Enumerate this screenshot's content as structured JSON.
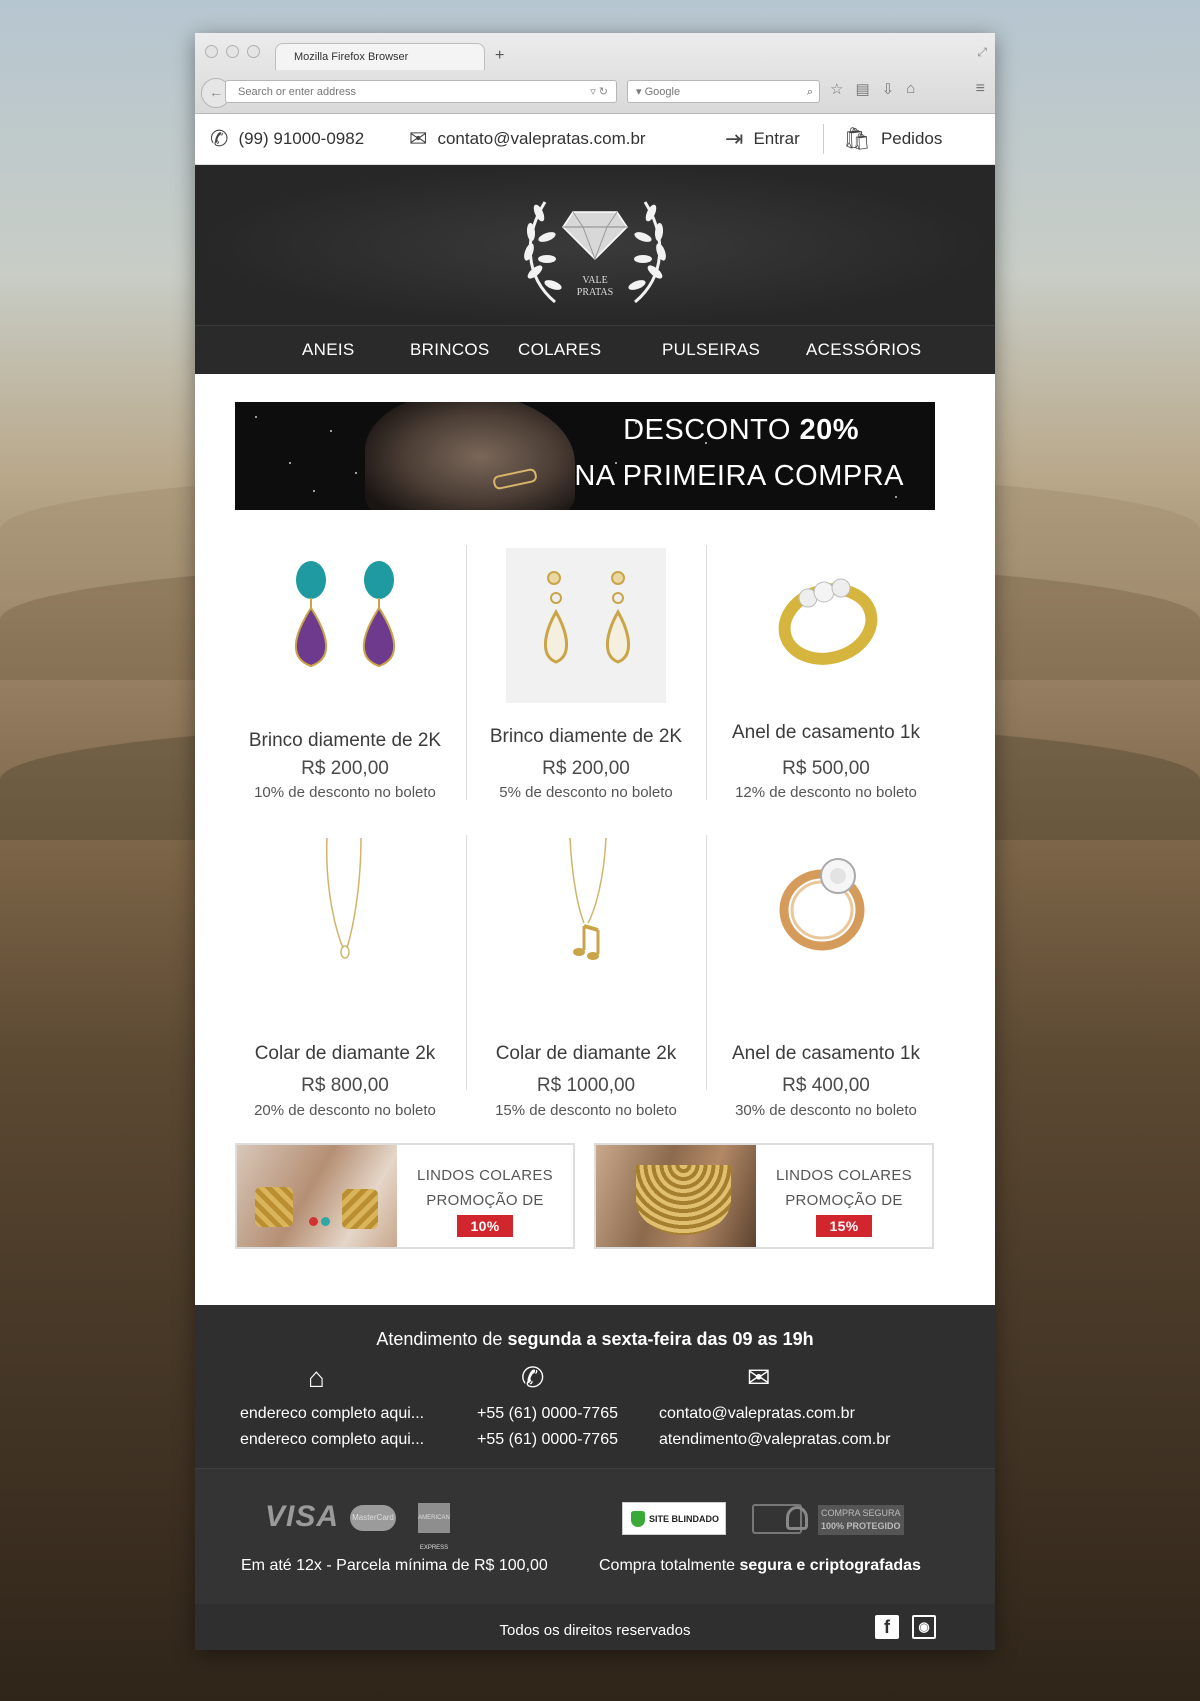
{
  "browser": {
    "tab_title": "Mozilla Firefox Browser",
    "url_placeholder": "Search or enter address",
    "search_placeholder": "Google"
  },
  "topbar": {
    "phone": "(99) 91000-0982",
    "email": "contato@valepratas.com.br",
    "login": "Entrar",
    "orders": "Pedidos"
  },
  "logo": {
    "line1": "VALE",
    "line2": "PRATAS"
  },
  "nav": [
    "ANEIS",
    "BRINCOS",
    "COLARES",
    "PULSEIRAS",
    "ACESSÓRIOS"
  ],
  "banner": {
    "line1_prefix": "DESCONTO ",
    "line1_bold": "20%",
    "line2": "NA PRIMEIRA COMPRA"
  },
  "products": [
    {
      "name": "Brinco diamente de 2K",
      "price": "R$ 200,00",
      "discount": "10% de desconto no boleto",
      "icon": "amethyst-earrings-icon"
    },
    {
      "name": "Brinco diamente de 2K",
      "price": "R$ 200,00",
      "discount": "5% de desconto no boleto",
      "icon": "gold-earrings-icon"
    },
    {
      "name": "Anel de casamento 1k",
      "price": "R$ 500,00",
      "discount": "12% de desconto no boleto",
      "icon": "gold-ring-icon"
    },
    {
      "name": "Colar de diamante 2k",
      "price": "R$ 800,00",
      "discount": "20% de desconto no boleto",
      "icon": "necklace-icon"
    },
    {
      "name": "Colar de diamante 2k",
      "price": "R$ 1000,00",
      "discount": "15% de desconto no boleto",
      "icon": "music-note-necklace-icon"
    },
    {
      "name": "Anel de casamento 1k",
      "price": "R$ 400,00",
      "discount": "30% de desconto no boleto",
      "icon": "diamond-ring-icon"
    }
  ],
  "promos": [
    {
      "line1": "LINDOS COLARES",
      "line2": "PROMOÇÃO DE",
      "badge": "10%"
    },
    {
      "line1": "LINDOS COLARES",
      "line2": "PROMOÇÃO DE",
      "badge": "15%"
    }
  ],
  "footer": {
    "hours_prefix": "Atendimento de ",
    "hours_bold": "segunda a sexta-feira das 09 as 19h",
    "address1": "endereco completo aqui...",
    "address2": "endereco completo aqui...",
    "phone1": "+55 (61) 0000-7765",
    "phone2": "+55 (61) 0000-7765",
    "email1": "contato@valepratas.com.br",
    "email2": "atendimento@valepratas.com.br",
    "visa": "VISA",
    "mastercard": "MasterCard",
    "amex": "AMERICAN EXPRESS",
    "blindado": "SITE BLINDADO",
    "secure1": "COMPRA SEGURA",
    "secure2": "100% PROTEGIDO",
    "installments": "Em até 12x - Parcela mínima de R$ 100,00",
    "secure_prefix": "Compra totalmente ",
    "secure_bold": "segura e criptografadas",
    "rights": "Todos os direitos reservados"
  },
  "colors": {
    "accent_red": "#d1262d",
    "dark": "#2a2a2a",
    "footer": "#2f2f2f"
  }
}
